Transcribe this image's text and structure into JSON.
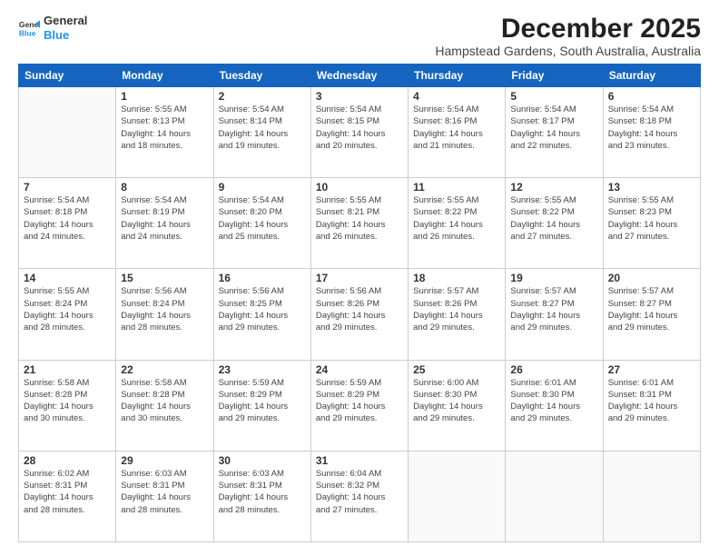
{
  "logo": {
    "general": "General",
    "blue": "Blue"
  },
  "title": "December 2025",
  "location": "Hampstead Gardens, South Australia, Australia",
  "days_of_week": [
    "Sunday",
    "Monday",
    "Tuesday",
    "Wednesday",
    "Thursday",
    "Friday",
    "Saturday"
  ],
  "weeks": [
    [
      {
        "day": "",
        "info": ""
      },
      {
        "day": "1",
        "info": "Sunrise: 5:55 AM\nSunset: 8:13 PM\nDaylight: 14 hours\nand 18 minutes."
      },
      {
        "day": "2",
        "info": "Sunrise: 5:54 AM\nSunset: 8:14 PM\nDaylight: 14 hours\nand 19 minutes."
      },
      {
        "day": "3",
        "info": "Sunrise: 5:54 AM\nSunset: 8:15 PM\nDaylight: 14 hours\nand 20 minutes."
      },
      {
        "day": "4",
        "info": "Sunrise: 5:54 AM\nSunset: 8:16 PM\nDaylight: 14 hours\nand 21 minutes."
      },
      {
        "day": "5",
        "info": "Sunrise: 5:54 AM\nSunset: 8:17 PM\nDaylight: 14 hours\nand 22 minutes."
      },
      {
        "day": "6",
        "info": "Sunrise: 5:54 AM\nSunset: 8:18 PM\nDaylight: 14 hours\nand 23 minutes."
      }
    ],
    [
      {
        "day": "7",
        "info": "Sunrise: 5:54 AM\nSunset: 8:18 PM\nDaylight: 14 hours\nand 24 minutes."
      },
      {
        "day": "8",
        "info": "Sunrise: 5:54 AM\nSunset: 8:19 PM\nDaylight: 14 hours\nand 24 minutes."
      },
      {
        "day": "9",
        "info": "Sunrise: 5:54 AM\nSunset: 8:20 PM\nDaylight: 14 hours\nand 25 minutes."
      },
      {
        "day": "10",
        "info": "Sunrise: 5:55 AM\nSunset: 8:21 PM\nDaylight: 14 hours\nand 26 minutes."
      },
      {
        "day": "11",
        "info": "Sunrise: 5:55 AM\nSunset: 8:22 PM\nDaylight: 14 hours\nand 26 minutes."
      },
      {
        "day": "12",
        "info": "Sunrise: 5:55 AM\nSunset: 8:22 PM\nDaylight: 14 hours\nand 27 minutes."
      },
      {
        "day": "13",
        "info": "Sunrise: 5:55 AM\nSunset: 8:23 PM\nDaylight: 14 hours\nand 27 minutes."
      }
    ],
    [
      {
        "day": "14",
        "info": "Sunrise: 5:55 AM\nSunset: 8:24 PM\nDaylight: 14 hours\nand 28 minutes."
      },
      {
        "day": "15",
        "info": "Sunrise: 5:56 AM\nSunset: 8:24 PM\nDaylight: 14 hours\nand 28 minutes."
      },
      {
        "day": "16",
        "info": "Sunrise: 5:56 AM\nSunset: 8:25 PM\nDaylight: 14 hours\nand 29 minutes."
      },
      {
        "day": "17",
        "info": "Sunrise: 5:56 AM\nSunset: 8:26 PM\nDaylight: 14 hours\nand 29 minutes."
      },
      {
        "day": "18",
        "info": "Sunrise: 5:57 AM\nSunset: 8:26 PM\nDaylight: 14 hours\nand 29 minutes."
      },
      {
        "day": "19",
        "info": "Sunrise: 5:57 AM\nSunset: 8:27 PM\nDaylight: 14 hours\nand 29 minutes."
      },
      {
        "day": "20",
        "info": "Sunrise: 5:57 AM\nSunset: 8:27 PM\nDaylight: 14 hours\nand 29 minutes."
      }
    ],
    [
      {
        "day": "21",
        "info": "Sunrise: 5:58 AM\nSunset: 8:28 PM\nDaylight: 14 hours\nand 30 minutes."
      },
      {
        "day": "22",
        "info": "Sunrise: 5:58 AM\nSunset: 8:28 PM\nDaylight: 14 hours\nand 30 minutes."
      },
      {
        "day": "23",
        "info": "Sunrise: 5:59 AM\nSunset: 8:29 PM\nDaylight: 14 hours\nand 29 minutes."
      },
      {
        "day": "24",
        "info": "Sunrise: 5:59 AM\nSunset: 8:29 PM\nDaylight: 14 hours\nand 29 minutes."
      },
      {
        "day": "25",
        "info": "Sunrise: 6:00 AM\nSunset: 8:30 PM\nDaylight: 14 hours\nand 29 minutes."
      },
      {
        "day": "26",
        "info": "Sunrise: 6:01 AM\nSunset: 8:30 PM\nDaylight: 14 hours\nand 29 minutes."
      },
      {
        "day": "27",
        "info": "Sunrise: 6:01 AM\nSunset: 8:31 PM\nDaylight: 14 hours\nand 29 minutes."
      }
    ],
    [
      {
        "day": "28",
        "info": "Sunrise: 6:02 AM\nSunset: 8:31 PM\nDaylight: 14 hours\nand 28 minutes."
      },
      {
        "day": "29",
        "info": "Sunrise: 6:03 AM\nSunset: 8:31 PM\nDaylight: 14 hours\nand 28 minutes."
      },
      {
        "day": "30",
        "info": "Sunrise: 6:03 AM\nSunset: 8:31 PM\nDaylight: 14 hours\nand 28 minutes."
      },
      {
        "day": "31",
        "info": "Sunrise: 6:04 AM\nSunset: 8:32 PM\nDaylight: 14 hours\nand 27 minutes."
      },
      {
        "day": "",
        "info": ""
      },
      {
        "day": "",
        "info": ""
      },
      {
        "day": "",
        "info": ""
      }
    ]
  ]
}
